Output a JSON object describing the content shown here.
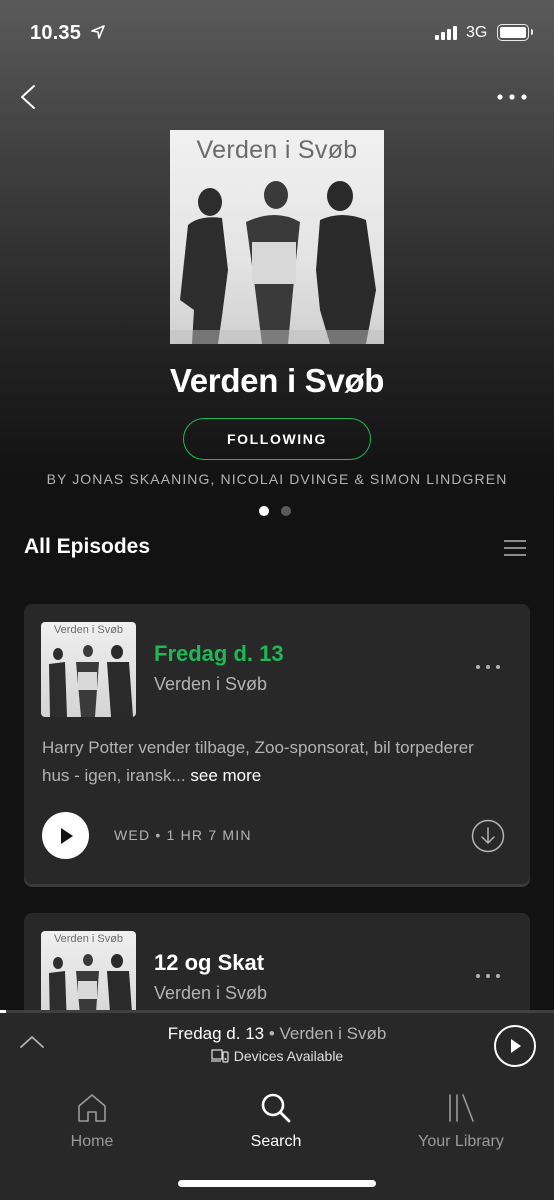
{
  "status_bar": {
    "time": "10.35",
    "network": "3G"
  },
  "podcast": {
    "cover_text": "Verden i Svøb",
    "title": "Verden i Svøb",
    "follow_label": "FOLLOWING",
    "authors": "BY JONAS SKAANING, NICOLAI DVINGE & SIMON LINDGREN"
  },
  "colors": {
    "accent": "#1db954",
    "background": "#121212",
    "card": "#282828",
    "muted_text": "#b3b3b3"
  },
  "episodes_section": {
    "title": "All Episodes"
  },
  "episodes": [
    {
      "title": "Fredag d. 13",
      "show": "Verden i Svøb",
      "thumb_text": "Verden i Svøb",
      "description": "Harry Potter vender tilbage, Zoo-sponsorat, bil torpederer hus - igen, iransk...",
      "see_more": "see more",
      "meta": "WED • 1 HR 7 MIN"
    },
    {
      "title": "12 og Skat",
      "show": "Verden i Svøb",
      "thumb_text": "Verden i Svøb"
    }
  ],
  "now_playing": {
    "episode": "Fredag d. 13",
    "separator": " • ",
    "show": "Verden i Svøb",
    "devices_label": "Devices Available",
    "progress": 0.01
  },
  "tabs": [
    {
      "label": "Home",
      "icon": "home-icon"
    },
    {
      "label": "Search",
      "icon": "search-icon",
      "active": true
    },
    {
      "label": "Your Library",
      "icon": "library-icon"
    }
  ]
}
